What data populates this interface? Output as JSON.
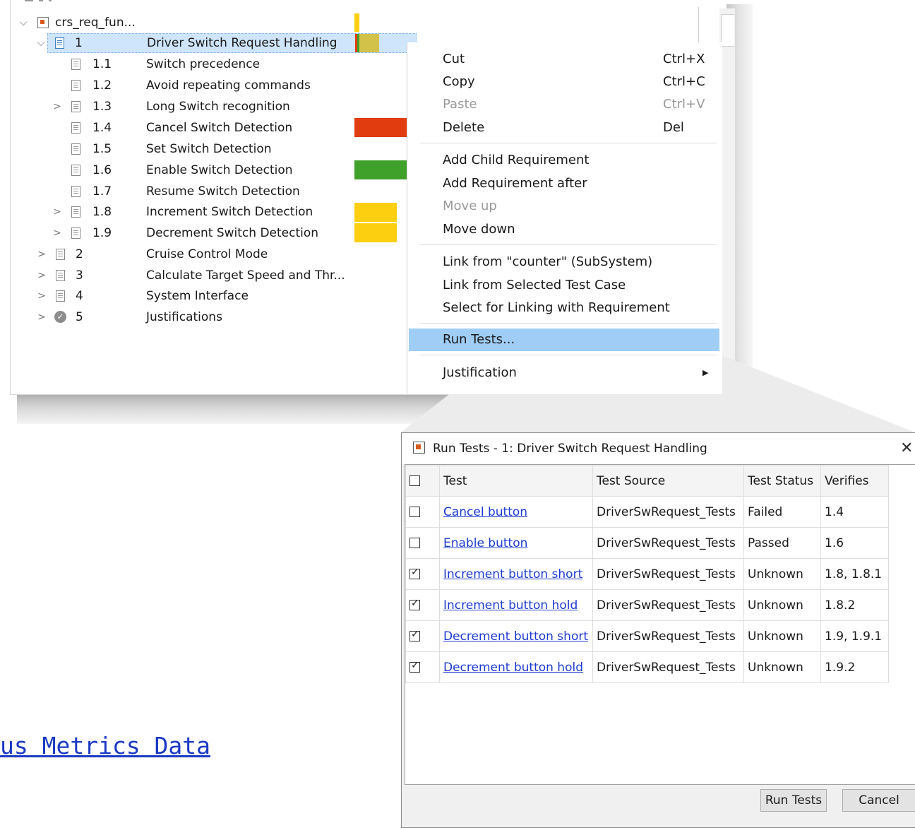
{
  "tree": {
    "root_label": "crs_req_fun...",
    "rows": [
      {
        "num": "1",
        "label": "Driver Switch Request Handling"
      },
      {
        "num": "1.1",
        "label": "Switch precedence"
      },
      {
        "num": "1.2",
        "label": "Avoid repeating commands"
      },
      {
        "num": "1.3",
        "label": "Long Switch recognition"
      },
      {
        "num": "1.4",
        "label": "Cancel Switch Detection"
      },
      {
        "num": "1.5",
        "label": "Set Switch Detection"
      },
      {
        "num": "1.6",
        "label": "Enable Switch Detection"
      },
      {
        "num": "1.7",
        "label": "Resume Switch Detection"
      },
      {
        "num": "1.8",
        "label": "Increment Switch Detection"
      },
      {
        "num": "1.9",
        "label": "Decrement Switch Detection"
      },
      {
        "num": "2",
        "label": "Cruise Control Mode"
      },
      {
        "num": "3",
        "label": "Calculate Target Speed and Thr..."
      },
      {
        "num": "4",
        "label": "System Interface"
      },
      {
        "num": "5",
        "label": "Justifications"
      }
    ],
    "status_colors": {
      "failed": "#e03c0f",
      "passed": "#3fa02a",
      "unknown": "#fcd010",
      "mixed": "#d2c24a"
    }
  },
  "context_menu": {
    "items": [
      {
        "label": "Cut",
        "shortcut": "Ctrl+X"
      },
      {
        "label": "Copy",
        "shortcut": "Ctrl+C"
      },
      {
        "label": "Paste",
        "shortcut": "Ctrl+V"
      },
      {
        "label": "Delete",
        "shortcut": "Del"
      },
      {
        "label": "Add Child Requirement"
      },
      {
        "label": "Add Requirement after"
      },
      {
        "label": "Move up"
      },
      {
        "label": "Move down"
      },
      {
        "label": "Link from \"counter\" (SubSystem)"
      },
      {
        "label": "Link from Selected Test Case"
      },
      {
        "label": "Select for Linking with Requirement"
      },
      {
        "label": "Run Tests..."
      },
      {
        "label": "Justification"
      }
    ]
  },
  "dialog": {
    "title": "Run Tests - 1: Driver Switch Request Handling",
    "close_glyph": "✕",
    "columns": [
      "Test",
      "Test Source",
      "Test Status",
      "Verifies"
    ],
    "rows": [
      {
        "test": "Cancel button",
        "source": "DriverSwRequest_Tests",
        "status": "Failed",
        "verifies": "1.4",
        "checked": false
      },
      {
        "test": "Enable button",
        "source": "DriverSwRequest_Tests",
        "status": "Passed",
        "verifies": "1.6",
        "checked": false
      },
      {
        "test": "Increment button short",
        "source": "DriverSwRequest_Tests",
        "status": "Unknown",
        "verifies": "1.8, 1.8.1",
        "checked": true
      },
      {
        "test": "Increment button hold",
        "source": "DriverSwRequest_Tests",
        "status": "Unknown",
        "verifies": "1.8.2",
        "checked": true
      },
      {
        "test": "Decrement button short",
        "source": "DriverSwRequest_Tests",
        "status": "Unknown",
        "verifies": "1.9, 1.9.1",
        "checked": true
      },
      {
        "test": "Decrement button hold",
        "source": "DriverSwRequest_Tests",
        "status": "Unknown",
        "verifies": "1.9.2",
        "checked": true
      }
    ],
    "run_button": "Run Tests",
    "cancel_button": "Cancel"
  },
  "background_link": "us Metrics Data"
}
